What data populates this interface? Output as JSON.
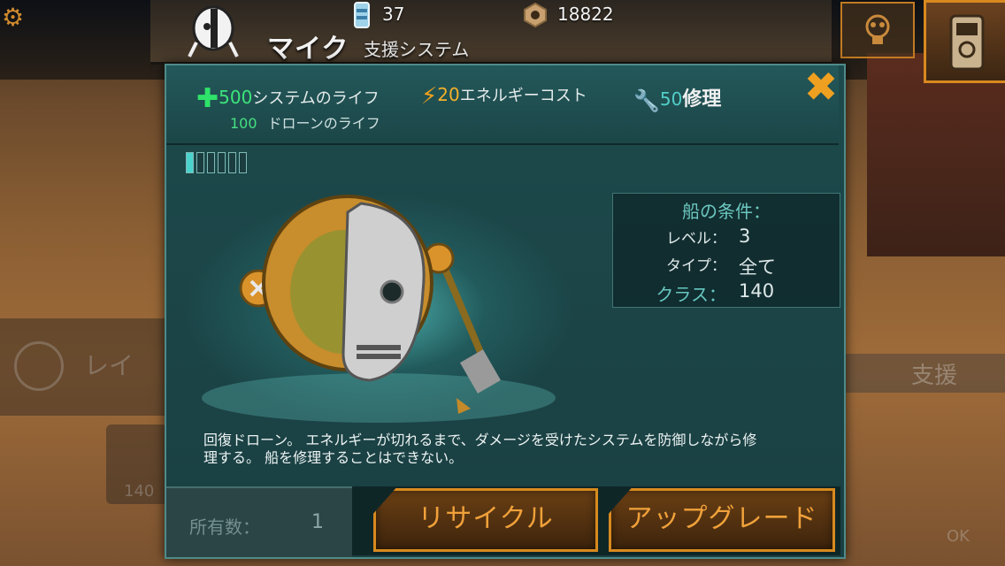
{
  "hud": {
    "title": "マイク",
    "subtitle": "支援システム",
    "cans": "37",
    "nuts": "18822"
  },
  "stats": {
    "life_value": "500",
    "life_label": "システムのライフ",
    "drone_life_value": "100",
    "drone_life_label": "ドローンのライフ",
    "energy_value": "20",
    "energy_label": "エネルギーコスト",
    "repair_value": "50",
    "repair_label": "修理"
  },
  "level": {
    "filled": 1,
    "total": 6
  },
  "requirements": {
    "title": "船の条件：",
    "level_key": "レベル：",
    "level_value": "3",
    "type_key": "タイプ：",
    "type_value": "全て",
    "class_key": "クラス：",
    "class_value": "140"
  },
  "description": "回復ドローン。 エネルギーが切れるまで、ダメージを受けたシステムを防御しながら修理する。 船を修理することはできない。",
  "owned": {
    "label": "所有数：",
    "value": "1"
  },
  "buttons": {
    "recycle": "リサイクル",
    "upgrade": "アップグレード"
  },
  "background": {
    "left_tab": "レイ",
    "right_tab": "支援",
    "ghost_number": "140",
    "ok": "OK"
  },
  "colors": {
    "accent_orange": "#d88a1e",
    "panel_teal": "#1d4a4c",
    "life_green": "#3de47a"
  }
}
